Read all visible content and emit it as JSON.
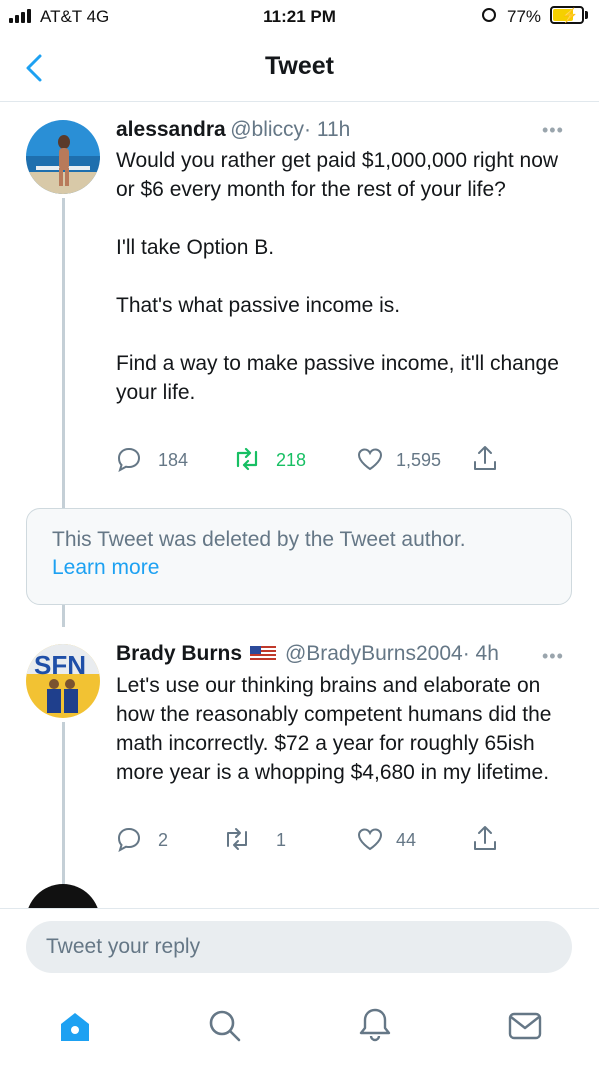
{
  "status_bar": {
    "carrier": "AT&T  4G",
    "time": "11:21 PM",
    "battery_percent": "77%",
    "battery_level": 0.77,
    "battery_color": "#f5d000"
  },
  "header": {
    "title": "Tweet",
    "back_icon": "chevron-left-icon"
  },
  "tweets": [
    {
      "name": "alessandra",
      "handle": "@bliccy",
      "time": "· 11h",
      "text": "Would you rather get paid $1,000,000 right now or $6 every month for the rest of your life?\n\nI'll take Option B.\n\nThat's what passive income is.\n\nFind a way to make passive income, it'll change your life.",
      "replies": "184",
      "retweets": "218",
      "likes": "1,595",
      "retweeted": true
    },
    {
      "name": "Brady Burns",
      "flag": "us-flag-icon",
      "handle": "@BradyBurns2004",
      "time": "· 4h",
      "text": "Let's use our thinking brains and elaborate on how the reasonably competent humans did the math incorrectly. $72 a year for roughly 65ish more year is a whopping $4,680 in my lifetime.",
      "replies": "2",
      "retweets": "1",
      "likes": "44",
      "retweeted": false
    }
  ],
  "deleted_notice": {
    "text": "This Tweet was deleted by the Tweet author.",
    "link": "Learn more"
  },
  "reply": {
    "placeholder": "Tweet your reply"
  },
  "tab_bar": [
    "home-icon",
    "search-icon",
    "notifications-icon",
    "messages-icon"
  ],
  "colors": {
    "accent": "#1da1f2",
    "retweet": "#17bf63",
    "secondary": "#657786"
  }
}
